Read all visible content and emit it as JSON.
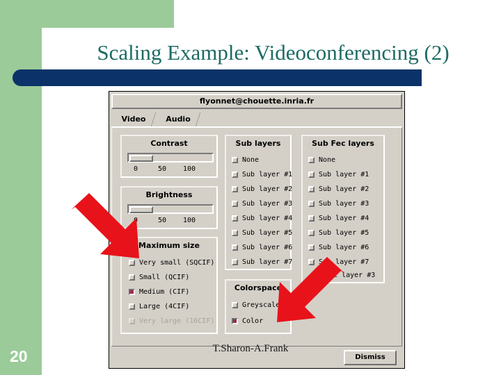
{
  "slide": {
    "title": "Scaling Example: Videoconferencing (2)",
    "number": "20",
    "footer": "T.Sharon-A.Frank",
    "accent_green": "#9bcb99",
    "accent_navy": "#0b3369",
    "title_color": "#1d6b63",
    "arrow_color": "#e8121a"
  },
  "dialog": {
    "title": "flyonnet@chouette.inria.fr",
    "tabs": [
      {
        "label": "Video",
        "selected": true
      },
      {
        "label": "Audio",
        "selected": false
      }
    ],
    "contrast": {
      "title": "Contrast",
      "scale": [
        "0",
        "50",
        "100"
      ],
      "value": 14
    },
    "brightness": {
      "title": "Brightness",
      "scale": [
        "0",
        "50",
        "100"
      ],
      "value": 14
    },
    "maximum_size": {
      "title": "Maximum size",
      "options": [
        {
          "label": "Very small (SQCIF)",
          "selected": false,
          "disabled": false
        },
        {
          "label": "Small (QCIF)",
          "selected": false,
          "disabled": false
        },
        {
          "label": "Medium (CIF)",
          "selected": true,
          "disabled": false
        },
        {
          "label": "Large (4CIF)",
          "selected": false,
          "disabled": false
        },
        {
          "label": "Very large (16CIF)",
          "selected": false,
          "disabled": true
        }
      ]
    },
    "sub_layers": {
      "title": "Sub layers",
      "options": [
        {
          "label": "None",
          "selected": false
        },
        {
          "label": "Sub layer #1",
          "selected": false
        },
        {
          "label": "Sub layer #2",
          "selected": false
        },
        {
          "label": "Sub layer #3",
          "selected": false
        },
        {
          "label": "Sub layer #4",
          "selected": false
        },
        {
          "label": "Sub layer #5",
          "selected": false
        },
        {
          "label": "Sub layer #6",
          "selected": false
        },
        {
          "label": "Sub layer #7",
          "selected": false
        }
      ]
    },
    "sub_fec_layers": {
      "title": "Sub Fec layers",
      "options": [
        {
          "label": "None",
          "selected": false
        },
        {
          "label": "Sub layer #1",
          "selected": false
        },
        {
          "label": "Sub layer #2",
          "selected": false
        },
        {
          "label": "Sub layer #3",
          "selected": false
        },
        {
          "label": "Sub layer #4",
          "selected": false
        },
        {
          "label": "Sub layer #5",
          "selected": false
        },
        {
          "label": "Sub layer #6",
          "selected": false
        },
        {
          "label": "Sub layer #7",
          "selected": false
        }
      ],
      "status": "Fec layer #3"
    },
    "colorspace": {
      "title": "Colorspace",
      "options": [
        {
          "label": "Greyscale",
          "selected": false
        },
        {
          "label": "Color",
          "selected": true
        }
      ]
    },
    "dismiss_label": "Dismiss"
  }
}
